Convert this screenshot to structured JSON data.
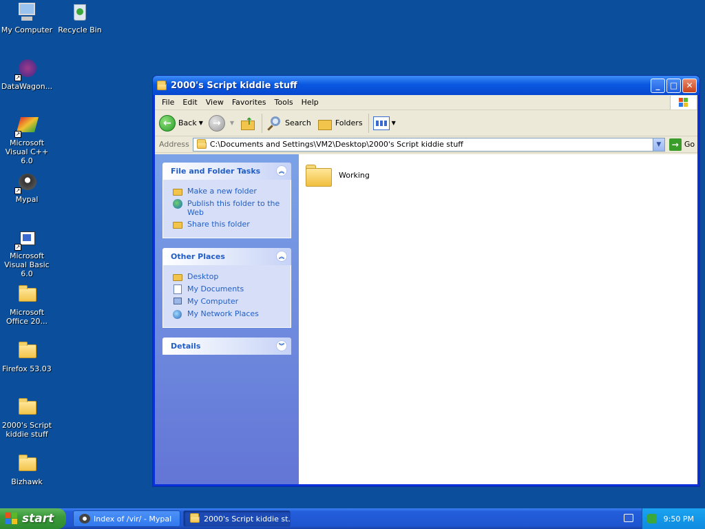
{
  "desktop": {
    "icons": [
      {
        "label": "My Computer"
      },
      {
        "label": "Recycle Bin"
      },
      {
        "label": "DataWagon..."
      },
      {
        "label": "Microsoft Visual C++ 6.0"
      },
      {
        "label": "Mypal"
      },
      {
        "label": "Microsoft Visual Basic 6.0"
      },
      {
        "label": "Microsoft Office 20..."
      },
      {
        "label": "Firefox 53.03"
      },
      {
        "label": "2000's Script kiddie stuff"
      },
      {
        "label": "Bizhawk"
      }
    ]
  },
  "window": {
    "title": "2000's Script kiddie stuff",
    "menu": [
      "File",
      "Edit",
      "View",
      "Favorites",
      "Tools",
      "Help"
    ],
    "toolbar": {
      "back": "Back",
      "search": "Search",
      "folders": "Folders"
    },
    "address": {
      "label": "Address",
      "value": "C:\\Documents and Settings\\VM2\\Desktop\\2000's Script kiddie stuff",
      "go": "Go"
    },
    "taskpane": {
      "file_tasks": {
        "title": "File and Folder Tasks",
        "items": [
          "Make a new folder",
          "Publish this folder to the Web",
          "Share this folder"
        ]
      },
      "other_places": {
        "title": "Other Places",
        "items": [
          "Desktop",
          "My Documents",
          "My Computer",
          "My Network Places"
        ]
      },
      "details": {
        "title": "Details"
      }
    },
    "files": [
      {
        "name": "Working"
      }
    ]
  },
  "taskbar": {
    "start": "start",
    "tasks": [
      {
        "label": "Index of /vir/ - Mypal"
      },
      {
        "label": "2000's Script kiddie st..."
      }
    ],
    "clock": "9:50 PM"
  },
  "colors": {
    "desktop_bg": "#0b4f9c",
    "titlebar": "#0a58e0",
    "taskpane_link": "#215dc6",
    "start_green": "#3b9a3b"
  }
}
